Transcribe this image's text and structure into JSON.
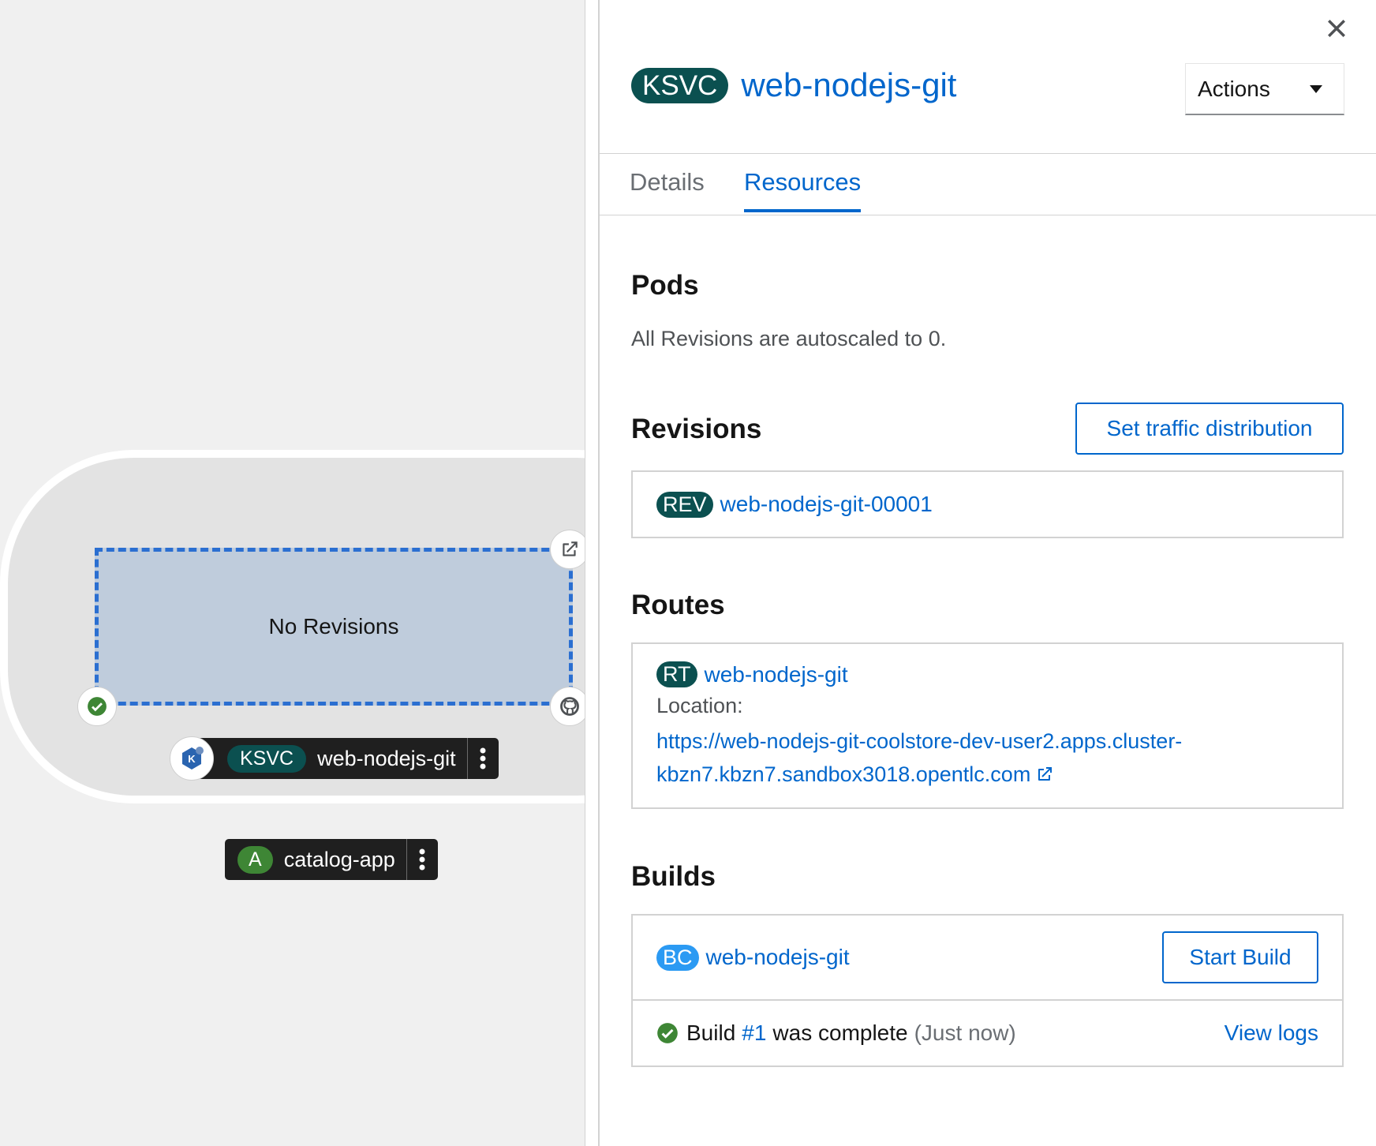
{
  "canvas": {
    "empty_text": "No Revisions",
    "ksvc_node": {
      "badge": "KSVC",
      "name": "web-nodejs-git"
    },
    "app_group": {
      "badge": "A",
      "name": "catalog-app"
    },
    "resize_handle": "||"
  },
  "panel": {
    "title_badge": "KSVC",
    "title": "web-nodejs-git",
    "actions_label": "Actions",
    "tabs": [
      {
        "label": "Details",
        "active": false
      },
      {
        "label": "Resources",
        "active": true
      }
    ],
    "pods": {
      "title": "Pods",
      "message": "All Revisions are autoscaled to 0."
    },
    "revisions": {
      "title": "Revisions",
      "button": "Set traffic distribution",
      "items": [
        {
          "badge": "REV",
          "name": "web-nodejs-git-00001"
        }
      ]
    },
    "routes": {
      "title": "Routes",
      "item": {
        "badge": "RT",
        "name": "web-nodejs-git"
      },
      "location_label": "Location:",
      "url_line1": "https://web-nodejs-git-coolstore-dev-user2.apps.cluster-",
      "url_line2": "kbzn7.kbzn7.sandbox3018.opentlc.com"
    },
    "builds": {
      "title": "Builds",
      "item": {
        "badge": "BC",
        "name": "web-nodejs-git"
      },
      "start_button": "Start Build",
      "status": {
        "prefix": "Build",
        "number": "#1",
        "suffix": "was complete",
        "time": "(Just now)"
      },
      "view_logs": "View logs"
    }
  },
  "colors": {
    "link": "#0066cc",
    "ksvc_badge": "#0b5050",
    "app_badge": "#3e8635",
    "bc_badge": "#2b9af3",
    "success": "#3e8635",
    "dashed_border": "#2b6fd1",
    "node_fill": "#bfccdc"
  },
  "icons": [
    "close-icon",
    "caret-down-icon",
    "external-link-icon",
    "check-circle-icon",
    "github-icon",
    "knative-icon",
    "kebab-icon"
  ]
}
